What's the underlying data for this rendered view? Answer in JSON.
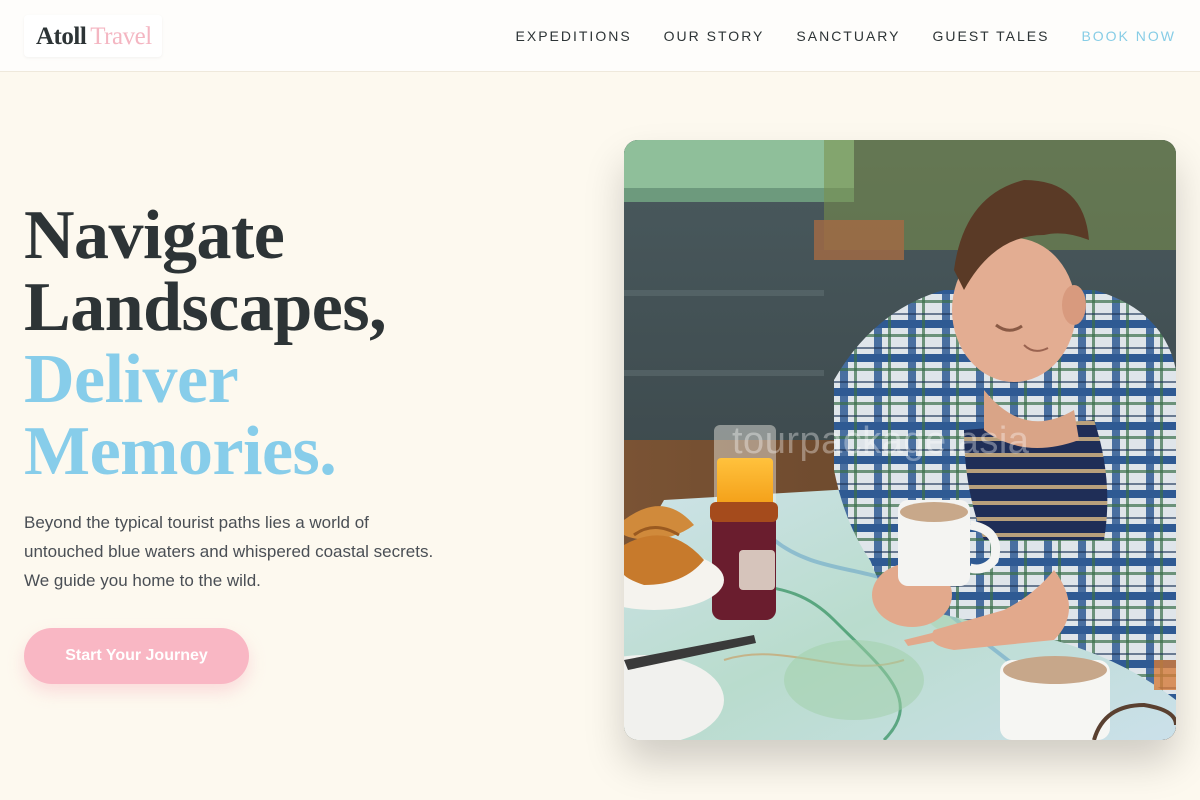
{
  "header": {
    "logo_word1": "Atoll",
    "logo_word2": "Travel",
    "nav": [
      {
        "label": "EXPEDITIONS"
      },
      {
        "label": "OUR STORY"
      },
      {
        "label": "SANCTUARY"
      },
      {
        "label": "GUEST TALES"
      },
      {
        "label": "BOOK NOW"
      }
    ]
  },
  "hero": {
    "title_line1": "Navigate",
    "title_line2": "Landscapes,",
    "title_line3": "Deliver",
    "title_line4": "Memories.",
    "description": "Beyond the typical tourist paths lies a world of untouched blue waters and whispered coastal secrets. We guide you home to the wild.",
    "cta_label": "Start Your Journey"
  },
  "photo": {
    "watermark": "tourpackage.asia"
  },
  "colors": {
    "background": "#fdf9ef",
    "text_dark": "#2d3436",
    "accent_blue": "#87cdea",
    "accent_pink": "#f9b7c4"
  }
}
